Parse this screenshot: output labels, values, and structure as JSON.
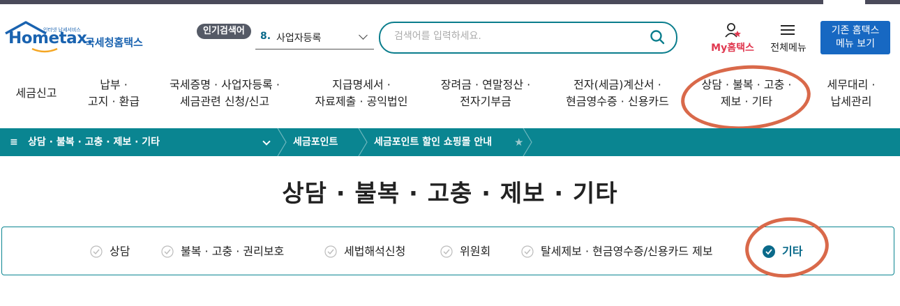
{
  "header": {
    "logo_tagline": "인터넷 납세서비스",
    "logo_main": "Hometax.",
    "logo_kor": "국세청홈택스",
    "popular_label": "인기검색어",
    "popular_rank": "8.",
    "popular_item": "사업자등록",
    "search_placeholder": "검색어를 입력하세요.",
    "my_label": "My홈택스",
    "all_menu_label": "전체메뉴",
    "old_home_line1": "기존 홈택스",
    "old_home_line2": "메뉴 보기"
  },
  "gnb": [
    {
      "line1": "세금신고",
      "line2": ""
    },
    {
      "line1": "납부 ·",
      "line2": "고지 · 환급"
    },
    {
      "line1": "국세증명 · 사업자등록 ·",
      "line2": "세금관련 신청/신고"
    },
    {
      "line1": "지급명세서 ·",
      "line2": "자료제출 · 공익법인"
    },
    {
      "line1": "장려금 · 연말정산 ·",
      "line2": "전자기부금"
    },
    {
      "line1": "전자(세금)계산서 ·",
      "line2": "현금영수증 · 신용카드"
    },
    {
      "line1": "상담 · 불복 · 고충 ·",
      "line2": "제보 · 기타"
    },
    {
      "line1": "세무대리 ·",
      "line2": "납세관리"
    }
  ],
  "breadcrumb": {
    "menu_glyph": "≡",
    "current": "상담 · 불복 · 고충 · 제보 · 기타",
    "item2": "세금포인트",
    "item3": "세금포인트 할인 쇼핑몰 안내",
    "star": "★"
  },
  "page_title": "상담 · 불복 · 고충 · 제보 · 기타",
  "tabs": [
    {
      "label": "상담",
      "active": false
    },
    {
      "label": "불복 · 고충 · 권리보호",
      "active": false
    },
    {
      "label": "세법해석신청",
      "active": false
    },
    {
      "label": "위원회",
      "active": false
    },
    {
      "label": "탈세제보 · 현금영수증/신용카드 제보",
      "active": false
    },
    {
      "label": "기타",
      "active": true
    }
  ],
  "colors": {
    "teal": "#0a8591",
    "brand_blue": "#1a63b0",
    "annotation": "#d9694a",
    "my_pink": "#e0384f"
  }
}
